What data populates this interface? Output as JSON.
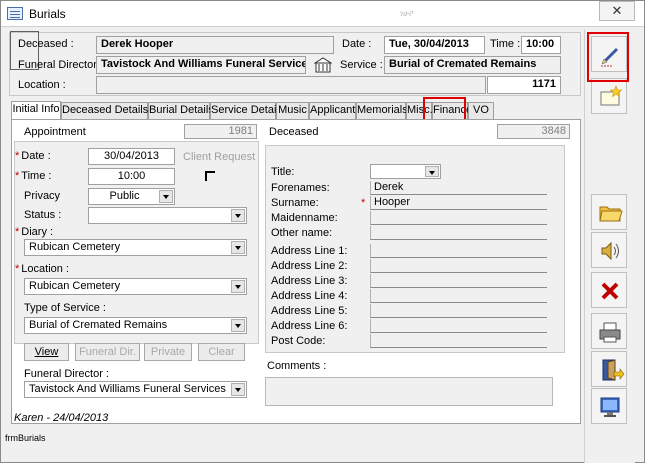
{
  "window": {
    "title": "Burials",
    "faint_title": "ነሁቦ",
    "close_glyph": "✕"
  },
  "header": {
    "deceased_label": "Deceased :",
    "deceased_value": "Derek Hooper",
    "date_label": "Date :",
    "date_value": "Tue, 30/04/2013",
    "time_label": "Time :",
    "time_value": "10:00",
    "funeral_director_label": "Funeral Director :",
    "funeral_director_value": "Tavistock And Williams Funeral Services",
    "service_label": "Service :",
    "service_value": "Burial of Cremated Remains",
    "location_label": "Location :",
    "location_value": "",
    "record_number": "1171"
  },
  "tabs": [
    {
      "label": "Initial Info"
    },
    {
      "label": "Deceased Details"
    },
    {
      "label": "Burial Details"
    },
    {
      "label": "Service Details"
    },
    {
      "label": "Music"
    },
    {
      "label": "Applicant"
    },
    {
      "label": "Memorials"
    },
    {
      "label": "Misc."
    },
    {
      "label": "Finance"
    },
    {
      "label": "VO"
    }
  ],
  "appointment": {
    "title": "Appointment",
    "number": "1981",
    "date_label": "Date :",
    "date_value": "30/04/2013",
    "client_request_label": "Client Request",
    "time_label": "Time :",
    "time_value": "10:00",
    "privacy_label": "Privacy",
    "privacy_value": "Public",
    "status_label": "Status :",
    "status_value": "",
    "diary_label": "Diary :",
    "diary_value": "Rubican Cemetery",
    "location_label": "Location :",
    "location_value": "Rubican Cemetery",
    "type_label": "Type of Service  :",
    "type_value": "Burial of Cremated Remains",
    "buttons": {
      "view": "View",
      "funeral_dir": "Funeral Dir.",
      "private": "Private",
      "clear": "Clear"
    },
    "funeral_director_label": "Funeral Director :",
    "funeral_director_value": "Tavistock And Williams Funeral Services"
  },
  "deceased": {
    "title": "Deceased",
    "number": "3848",
    "title_label": "Title:",
    "title_value": "",
    "forenames_label": "Forenames:",
    "forenames_value": "Derek",
    "surname_label": "Surname:",
    "surname_value": "Hooper",
    "maidenname_label": "Maidenname:",
    "othername_label": "Other name:",
    "address_labels": [
      "Address Line 1:",
      "Address Line 2:",
      "Address Line 3:",
      "Address Line 4:",
      "Address Line 5:",
      "Address Line 6:"
    ],
    "postcode_label": "Post Code:"
  },
  "comments_label": "Comments :",
  "footer": {
    "created_by": "Karen - 24/04/2013",
    "form_name": "frmBurials"
  },
  "sidebar_icons": [
    "edit-pencil-icon",
    "new-record-star-icon",
    "open-folder-icon",
    "sound-speaker-icon",
    "delete-x-icon",
    "print-icon",
    "exit-door-icon",
    "monitor-screen-icon"
  ],
  "colors": {
    "highlight_red": "#e00000",
    "required_star": "#c00000"
  }
}
